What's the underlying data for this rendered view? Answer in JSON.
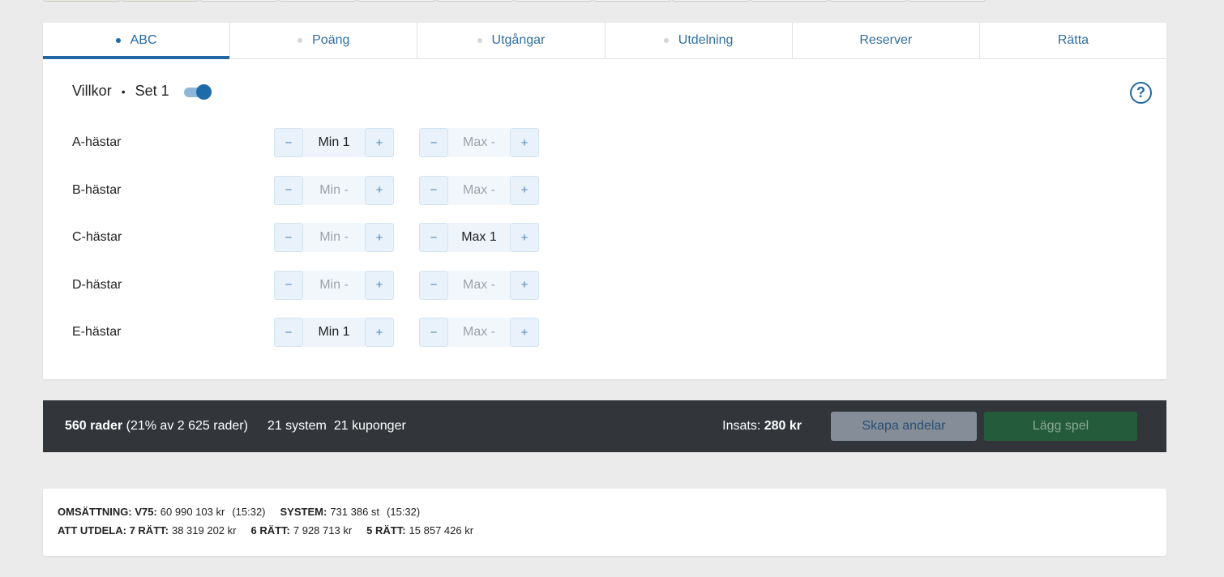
{
  "tabs": [
    {
      "label": "ABC",
      "active": true,
      "dot": true
    },
    {
      "label": "Poäng",
      "active": false,
      "dot": true
    },
    {
      "label": "Utgångar",
      "active": false,
      "dot": true
    },
    {
      "label": "Utdelning",
      "active": false,
      "dot": true
    },
    {
      "label": "Reserver",
      "active": false,
      "dot": false
    },
    {
      "label": "Rätta",
      "active": false,
      "dot": false
    }
  ],
  "header": {
    "title": "Villkor",
    "separator": "•",
    "set": "Set 1",
    "toggle_on": true,
    "help": "?"
  },
  "conditions": [
    {
      "label": "A-hästar",
      "min": "Min 1",
      "max": "Max -",
      "min_set": true,
      "max_set": false
    },
    {
      "label": "B-hästar",
      "min": "Min -",
      "max": "Max -",
      "min_set": false,
      "max_set": false
    },
    {
      "label": "C-hästar",
      "min": "Min -",
      "max": "Max 1",
      "min_set": false,
      "max_set": true
    },
    {
      "label": "D-hästar",
      "min": "Min -",
      "max": "Max -",
      "min_set": false,
      "max_set": false
    },
    {
      "label": "E-hästar",
      "min": "Min 1",
      "max": "Max -",
      "min_set": true,
      "max_set": false
    }
  ],
  "stepper": {
    "minus": "−",
    "plus": "+"
  },
  "summary": {
    "rows_bold": "560 rader",
    "rows_rest": " (21% av 2 625 rader)",
    "system": "21 system",
    "kuponger": "21 kuponger",
    "insats_label": "Insats: ",
    "insats_value": "280 kr",
    "share_button": "Skapa andelar",
    "play_button": "Lägg spel"
  },
  "footer": {
    "line1": [
      {
        "k": "OMSÄTTNING: V75:",
        "v": "60 990 103 kr",
        "t": "(15:32)"
      },
      {
        "k": "SYSTEM:",
        "v": "731 386 st",
        "t": "(15:32)"
      }
    ],
    "line2": [
      {
        "k": "ATT UTDELA: 7 RÄTT:",
        "v": "38 319 202 kr"
      },
      {
        "k": "6 RÄTT:",
        "v": "7 928 713 kr"
      },
      {
        "k": "5 RÄTT:",
        "v": "15 857 426 kr"
      }
    ]
  },
  "colors": {
    "accent": "#1f6aa8",
    "bar": "#32363b",
    "play": "#235b3b"
  }
}
